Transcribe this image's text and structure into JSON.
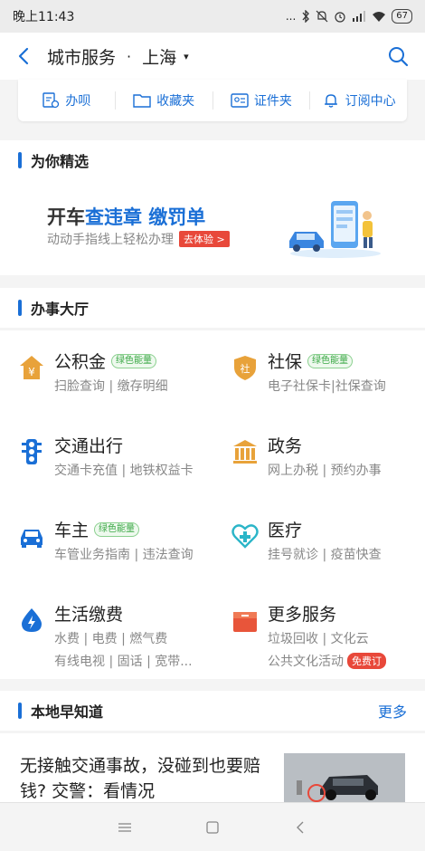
{
  "status_bar": {
    "time": "晚上11:43",
    "signal_dots": "...",
    "battery": "67"
  },
  "header": {
    "title": "城市服务",
    "separator": "·",
    "city": "上海",
    "caret": "▾"
  },
  "quick_bar": [
    {
      "label": "办呗",
      "icon": "form-icon"
    },
    {
      "label": "收藏夹",
      "icon": "folder-icon"
    },
    {
      "label": "证件夹",
      "icon": "id-card-icon"
    },
    {
      "label": "订阅中心",
      "icon": "bell-icon"
    }
  ],
  "featured": {
    "section_title": "为你精选",
    "banner_prefix": "开车",
    "banner_highlight": "查违章 缴罚单",
    "banner_sub": "动动手指线上轻松办理",
    "banner_button": "去体验 >"
  },
  "hall": {
    "section_title": "办事大厅",
    "green_tag": "绿色能量",
    "services": [
      {
        "name": "公积金",
        "desc": "扫脸查询 | 缴存明细",
        "icon": "house-fund-icon",
        "color": "#e8a23a"
      },
      {
        "name": "社保",
        "desc": "电子社保卡|社保查询",
        "icon": "social-security-icon",
        "color": "#e8a23a"
      },
      {
        "name": "交通出行",
        "desc": "交通卡充值 | 地铁权益卡",
        "icon": "traffic-light-icon",
        "color": "#1a6fd6"
      },
      {
        "name": "政务",
        "desc": "网上办税 | 预约办事",
        "icon": "government-icon",
        "color": "#e8a23a"
      },
      {
        "name": "车主",
        "desc": "车管业务指南 | 违法查询",
        "icon": "car-icon",
        "color": "#1a6fd6"
      },
      {
        "name": "医疗",
        "desc": "挂号就诊 | 疫苗快查",
        "icon": "medical-icon",
        "color": "#2bb5c8"
      },
      {
        "name": "生活缴费",
        "desc": "水费 | 电费 | 燃气费",
        "desc2": "有线电视 | 固话 | 宽带...",
        "icon": "water-drop-icon",
        "color": "#1a6fd6"
      },
      {
        "name": "更多服务",
        "desc": "垃圾回收 | 文化云",
        "desc2": "公共文化活动",
        "free_tag": "免费订",
        "icon": "more-services-icon",
        "color": "#e8553a"
      }
    ]
  },
  "local_news": {
    "section_title": "本地早知道",
    "more_label": "更多",
    "headline": "无接触交通事故，没碰到也要赔钱? 交警：看情况"
  }
}
